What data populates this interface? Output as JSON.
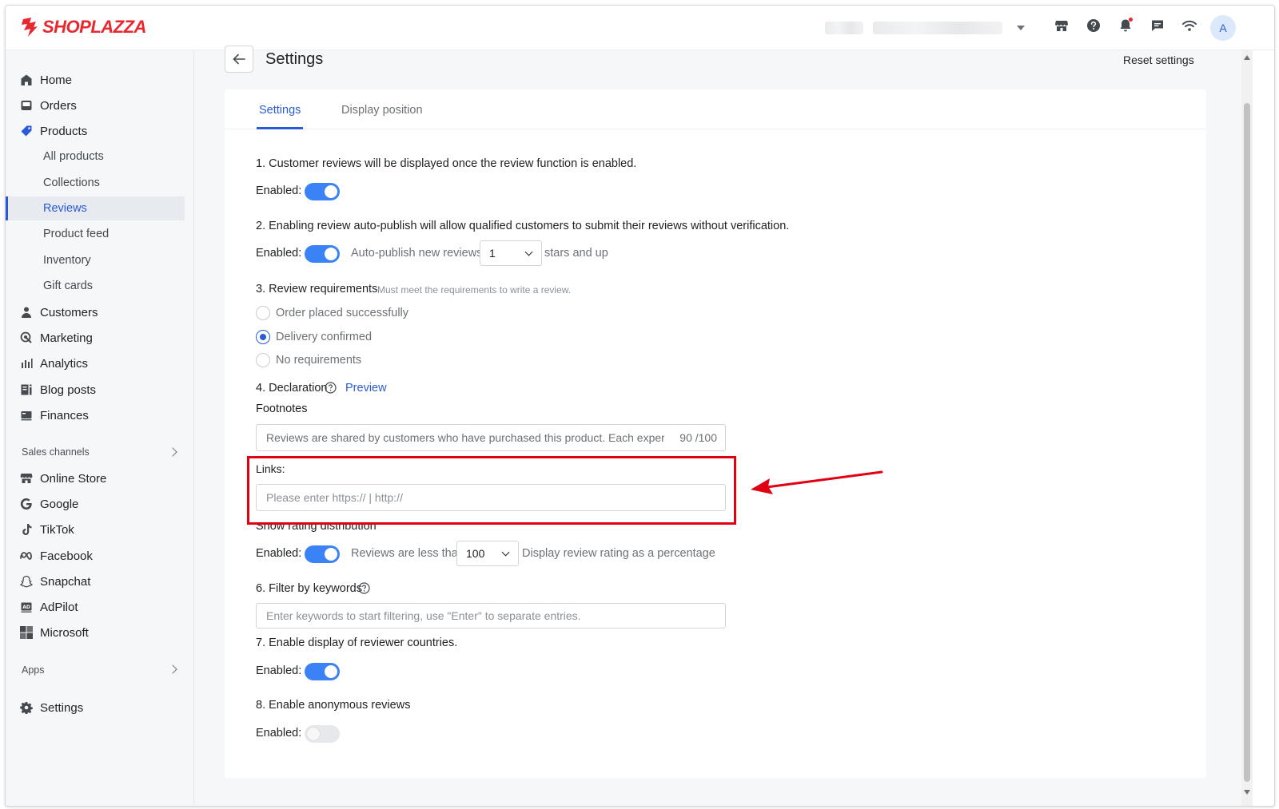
{
  "brand": {
    "logo_text": "SHOPLAZZA",
    "color": "#e8272f"
  },
  "topbar": {
    "avatar_letter": "A",
    "icons": [
      "store-icon",
      "help-icon",
      "bell-icon",
      "chat-icon",
      "wifi-icon"
    ]
  },
  "sidebar": {
    "items": [
      {
        "label": "Home",
        "icon": "home-icon"
      },
      {
        "label": "Orders",
        "icon": "orders-icon"
      },
      {
        "label": "Products",
        "icon": "tag-icon"
      },
      {
        "label": "All products"
      },
      {
        "label": "Collections"
      },
      {
        "label": "Reviews"
      },
      {
        "label": "Product feed"
      },
      {
        "label": "Inventory"
      },
      {
        "label": "Gift cards"
      },
      {
        "label": "Customers",
        "icon": "person-icon"
      },
      {
        "label": "Marketing",
        "icon": "marketing-icon"
      },
      {
        "label": "Analytics",
        "icon": "analytics-icon"
      },
      {
        "label": "Blog posts",
        "icon": "blog-icon"
      },
      {
        "label": "Finances",
        "icon": "finances-icon"
      },
      {
        "label": "Online Store",
        "icon": "store-icon"
      },
      {
        "label": "Google",
        "icon": "google-icon"
      },
      {
        "label": "TikTok",
        "icon": "tiktok-icon"
      },
      {
        "label": "Facebook",
        "icon": "meta-icon"
      },
      {
        "label": "Snapchat",
        "icon": "snapchat-icon"
      },
      {
        "label": "AdPilot",
        "icon": "adpilot-icon"
      },
      {
        "label": "Microsoft",
        "icon": "microsoft-icon"
      },
      {
        "label": "Settings",
        "icon": "gear-icon"
      }
    ],
    "section_sales_channels": "Sales channels",
    "section_apps": "Apps"
  },
  "page": {
    "title": "Settings",
    "reset_label": "Reset settings",
    "tabs": [
      "Settings",
      "Display position"
    ]
  },
  "settings": {
    "s1_text": "1. Customer reviews will be displayed once the review function is enabled.",
    "enabled_label": "Enabled",
    "colon": ":",
    "s2_text": "2. Enabling review auto-publish will allow qualified customers to submit their reviews without verification.",
    "s2_auto_publish": "Auto-publish new reviews",
    "s2_select_value": "1",
    "s2_suffix": "stars and up",
    "s3_text": "3. Review requirements",
    "s3_hint": "Must meet the requirements to write a review.",
    "s3_options": [
      "Order placed successfully",
      "Delivery confirmed",
      "No requirements"
    ],
    "s3_selected": "Delivery confirmed",
    "s4_text": "4. Declaration",
    "s4_preview": "Preview",
    "footnotes_label": "Footnotes",
    "footnotes_value": "Reviews are shared by customers who have purchased this product. Each experience",
    "footnotes_counter": "90 /100",
    "links_label": "Links:",
    "links_placeholder": "Please enter https:// | http://",
    "s5_text": "Show rating distribution",
    "s5_less_than": "Reviews are less than",
    "s5_select_value": "100",
    "s5_suffix": "Display review rating as a percentage",
    "s6_text": "6. Filter by keywords",
    "s6_placeholder": "Enter keywords to start filtering, use \"Enter\" to separate entries.",
    "s7_text": "7. Enable display of reviewer countries.",
    "s8_text": "8. Enable anonymous reviews",
    "toggles": {
      "s1": true,
      "s2": true,
      "s5": true,
      "s7": true,
      "s8": false
    }
  },
  "colors": {
    "accent": "#2a5bd7",
    "toggle_on": "#3b82f6",
    "highlight": "#e00012"
  }
}
